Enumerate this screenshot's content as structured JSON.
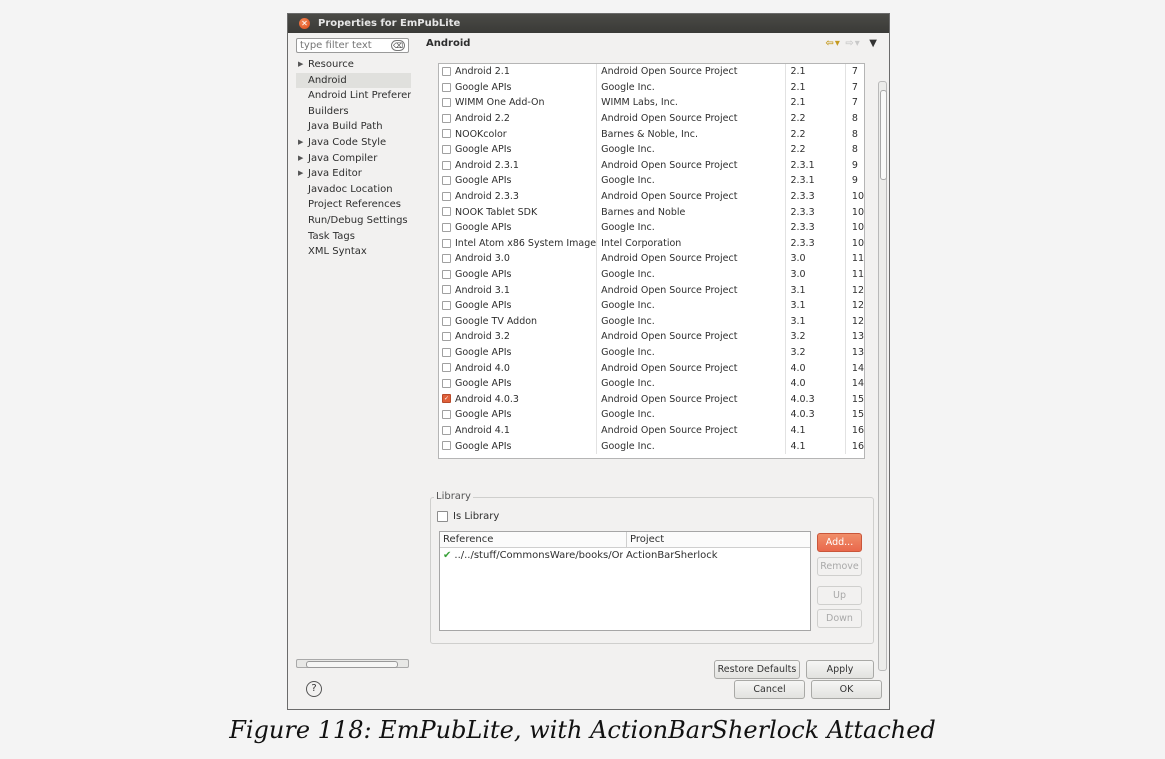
{
  "window": {
    "title": "Properties for EmPubLite"
  },
  "sidebar": {
    "filter_placeholder": "type filter text",
    "items": [
      {
        "label": "Resource",
        "expandable": true,
        "selected": false
      },
      {
        "label": "Android",
        "expandable": false,
        "selected": true
      },
      {
        "label": "Android Lint Preferences",
        "expandable": false,
        "selected": false
      },
      {
        "label": "Builders",
        "expandable": false,
        "selected": false
      },
      {
        "label": "Java Build Path",
        "expandable": false,
        "selected": false
      },
      {
        "label": "Java Code Style",
        "expandable": true,
        "selected": false
      },
      {
        "label": "Java Compiler",
        "expandable": true,
        "selected": false
      },
      {
        "label": "Java Editor",
        "expandable": true,
        "selected": false
      },
      {
        "label": "Javadoc Location",
        "expandable": false,
        "selected": false
      },
      {
        "label": "Project References",
        "expandable": false,
        "selected": false
      },
      {
        "label": "Run/Debug Settings",
        "expandable": false,
        "selected": false
      },
      {
        "label": "Task Tags",
        "expandable": false,
        "selected": false
      },
      {
        "label": "XML Syntax",
        "expandable": false,
        "selected": false
      }
    ]
  },
  "page": {
    "title": "Android"
  },
  "targets": [
    {
      "name": "Android 2.1",
      "vendor": "Android Open Source Project",
      "platform": "2.1",
      "api": "7",
      "checked": false
    },
    {
      "name": "Google APIs",
      "vendor": "Google Inc.",
      "platform": "2.1",
      "api": "7",
      "checked": false
    },
    {
      "name": "WIMM One Add-On",
      "vendor": "WIMM Labs, Inc.",
      "platform": "2.1",
      "api": "7",
      "checked": false
    },
    {
      "name": "Android 2.2",
      "vendor": "Android Open Source Project",
      "platform": "2.2",
      "api": "8",
      "checked": false
    },
    {
      "name": "NOOKcolor",
      "vendor": "Barnes & Noble, Inc.",
      "platform": "2.2",
      "api": "8",
      "checked": false
    },
    {
      "name": "Google APIs",
      "vendor": "Google Inc.",
      "platform": "2.2",
      "api": "8",
      "checked": false
    },
    {
      "name": "Android 2.3.1",
      "vendor": "Android Open Source Project",
      "platform": "2.3.1",
      "api": "9",
      "checked": false
    },
    {
      "name": "Google APIs",
      "vendor": "Google Inc.",
      "platform": "2.3.1",
      "api": "9",
      "checked": false
    },
    {
      "name": "Android 2.3.3",
      "vendor": "Android Open Source Project",
      "platform": "2.3.3",
      "api": "10",
      "checked": false
    },
    {
      "name": "NOOK Tablet SDK",
      "vendor": "Barnes and Noble",
      "platform": "2.3.3",
      "api": "10",
      "checked": false
    },
    {
      "name": "Google APIs",
      "vendor": "Google Inc.",
      "platform": "2.3.3",
      "api": "10",
      "checked": false
    },
    {
      "name": "Intel Atom x86 System Image",
      "vendor": "Intel Corporation",
      "platform": "2.3.3",
      "api": "10",
      "checked": false
    },
    {
      "name": "Android 3.0",
      "vendor": "Android Open Source Project",
      "platform": "3.0",
      "api": "11",
      "checked": false
    },
    {
      "name": "Google APIs",
      "vendor": "Google Inc.",
      "platform": "3.0",
      "api": "11",
      "checked": false
    },
    {
      "name": "Android 3.1",
      "vendor": "Android Open Source Project",
      "platform": "3.1",
      "api": "12",
      "checked": false
    },
    {
      "name": "Google APIs",
      "vendor": "Google Inc.",
      "platform": "3.1",
      "api": "12",
      "checked": false
    },
    {
      "name": "Google TV Addon",
      "vendor": "Google Inc.",
      "platform": "3.1",
      "api": "12",
      "checked": false
    },
    {
      "name": "Android 3.2",
      "vendor": "Android Open Source Project",
      "platform": "3.2",
      "api": "13",
      "checked": false
    },
    {
      "name": "Google APIs",
      "vendor": "Google Inc.",
      "platform": "3.2",
      "api": "13",
      "checked": false
    },
    {
      "name": "Android 4.0",
      "vendor": "Android Open Source Project",
      "platform": "4.0",
      "api": "14",
      "checked": false
    },
    {
      "name": "Google APIs",
      "vendor": "Google Inc.",
      "platform": "4.0",
      "api": "14",
      "checked": false
    },
    {
      "name": "Android 4.0.3",
      "vendor": "Android Open Source Project",
      "platform": "4.0.3",
      "api": "15",
      "checked": true
    },
    {
      "name": "Google APIs",
      "vendor": "Google Inc.",
      "platform": "4.0.3",
      "api": "15",
      "checked": false
    },
    {
      "name": "Android 4.1",
      "vendor": "Android Open Source Project",
      "platform": "4.1",
      "api": "16",
      "checked": false
    },
    {
      "name": "Google APIs",
      "vendor": "Google Inc.",
      "platform": "4.1",
      "api": "16",
      "checked": false
    }
  ],
  "library": {
    "legend": "Library",
    "is_library_label": "Is Library",
    "is_library_checked": false,
    "columns": [
      "Reference",
      "Project"
    ],
    "rows": [
      {
        "reference": "../../stuff/CommonsWare/books/Omnibus",
        "project": "ActionBarSherlock"
      }
    ],
    "buttons": {
      "add": "Add...",
      "remove": "Remove",
      "up": "Up",
      "down": "Down"
    }
  },
  "footer": {
    "restore_defaults": "Restore Defaults",
    "apply": "Apply",
    "cancel": "Cancel",
    "ok": "OK",
    "help_glyph": "?"
  },
  "caption": "Figure 118: EmPubLite, with ActionBarSherlock Attached",
  "colors": {
    "accent": "#e9684c",
    "check": "#3aa13a",
    "titlebar": "#3c3b37"
  }
}
